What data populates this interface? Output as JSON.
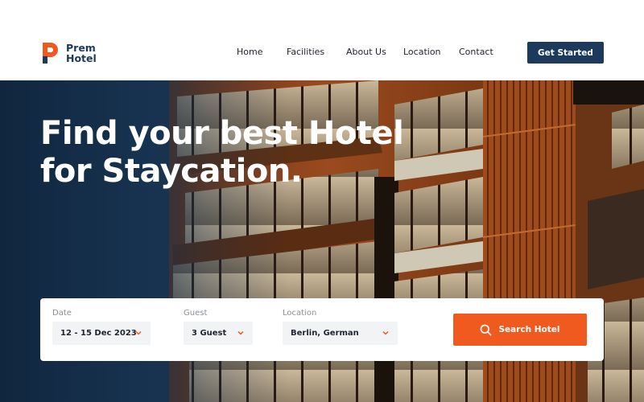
{
  "brand": {
    "name_line1": "Prem",
    "name_line2": "Hotel",
    "primary_color": "#1b3a5c",
    "accent_color": "#f05a1e"
  },
  "nav": {
    "items": [
      {
        "label": "Home"
      },
      {
        "label": "Facilities"
      },
      {
        "label": "About Us"
      },
      {
        "label": "Location"
      },
      {
        "label": "Contact"
      }
    ],
    "cta_label": "Get Started"
  },
  "hero": {
    "title_line1": "Find your best Hotel",
    "title_line2": "for Staycation."
  },
  "search": {
    "date": {
      "label": "Date",
      "value": "12 - 15 Dec 2023",
      "icon": "chevron-down-icon"
    },
    "guest": {
      "label": "Guest",
      "value": "3 Guest",
      "icon": "chevron-down-icon"
    },
    "location": {
      "label": "Location",
      "value": "Berlin, German",
      "icon": "chevron-down-icon"
    },
    "button_label": "Search Hotel",
    "button_icon": "search-icon"
  }
}
